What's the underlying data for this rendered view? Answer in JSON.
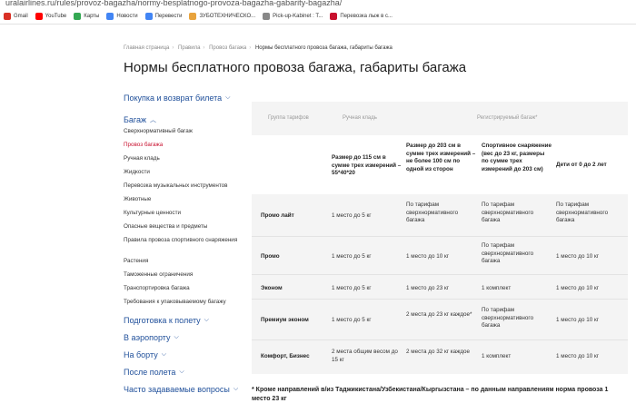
{
  "browser": {
    "url": "uralairlines.ru/rules/provoz-bagazha/normy-besplatnogo-provoza-bagazha-gabarity-bagazha/",
    "bookmarks": [
      {
        "label": "Gmail",
        "icon": "gmail-icon",
        "color": "#d93025"
      },
      {
        "label": "YouTube",
        "icon": "youtube-icon",
        "color": "#ff0000"
      },
      {
        "label": "Карты",
        "icon": "maps-icon",
        "color": "#34a853"
      },
      {
        "label": "Новости",
        "icon": "news-icon",
        "color": "#4285f4"
      },
      {
        "label": "Перевести",
        "icon": "translate-icon",
        "color": "#4285f4"
      },
      {
        "label": "ЗУБОТЕХНИЧЕСКО...",
        "icon": "page-icon",
        "color": "#e8a33d"
      },
      {
        "label": "Pick-up-Kabinet : T...",
        "icon": "page-icon",
        "color": "#888888"
      },
      {
        "label": "Перевозка лыж в с...",
        "icon": "page-icon",
        "color": "#c8102e"
      }
    ]
  },
  "breadcrumb": {
    "items": [
      "Главная страница",
      "Правила",
      "Провоз багажа"
    ],
    "current": "Нормы бесплатного провоза багажа, габариты багажа"
  },
  "page": {
    "title": "Нормы бесплатного провоза багажа, габариты багажа"
  },
  "sidebar": {
    "sections": {
      "purchase": "Покупка и возврат билета",
      "baggage": "Багаж",
      "prep": "Подготовка к полету",
      "airport": "В аэропорту",
      "onboard": "На борту",
      "after": "После полета",
      "faq": "Часто задаваемые вопросы"
    },
    "baggage_items": [
      "Сверхнормативный багаж",
      "Провоз багажа",
      "Ручная кладь",
      "Жидкости",
      "Перевозка музыкальных инструментов",
      "Животные",
      "Культурные ценности",
      "Опасные вещества и предметы",
      "Правила провоза спортивного снаряжения",
      "Растения",
      "Таможенные ограничения",
      "Транспортировка багажа",
      "Требования к упаковываемому багажу"
    ]
  },
  "table": {
    "head": {
      "group": "Группа тарифов",
      "hand": "Ручная кладь",
      "registered": "Регистрируемый багаж*"
    },
    "subhead": {
      "hand": "Размер до 115 см в сумме трех измерений – 55*40*20",
      "reg": "Размер до 203 см в сумме трех измерений – не более 100 см по одной из сторон",
      "sport": "Спортивное снаряжение (вес до 23 кг, размеры по сумме трех измерений до 203 см)",
      "kids": "Дети от 0 до 2 лет"
    },
    "rows": [
      {
        "name": "Промо лайт",
        "hand": "1 место до 5 кг",
        "reg": "По тарифам сверхнормативного багажа",
        "sport": "По тарифам сверхнормативного багажа",
        "kids": "По тарифам сверхнормативного багажа"
      },
      {
        "name": "Промо",
        "hand": "1 место до 5 кг",
        "reg": "1 место до 10 кг",
        "sport": "По тарифам сверхнормативного багажа",
        "kids": "1 место до 10 кг"
      },
      {
        "name": "Эконом",
        "hand": "1 место до 5 кг",
        "reg": "1 место до 23 кг",
        "sport": "1 комплект",
        "kids": "1 место до 10 кг"
      },
      {
        "name": "Премиум эконом",
        "hand": "1 место до 5 кг",
        "reg": "2 места до 23 кг каждое*",
        "sport": "По тарифам сверхнормативного багажа",
        "kids": "1 место до 10 кг"
      },
      {
        "name": "Комфорт, Бизнес",
        "hand": "2 места общим весом до 15 кг",
        "reg": "2 места до 32 кг каждое",
        "sport": "1 комплект",
        "kids": "1 место до 10 кг"
      }
    ]
  },
  "footnote": "* Кроме направлений в/из Таджикистана/Узбекистана/Кыргызстана – по данным направлениям норма провоза 1 место 23 кг"
}
